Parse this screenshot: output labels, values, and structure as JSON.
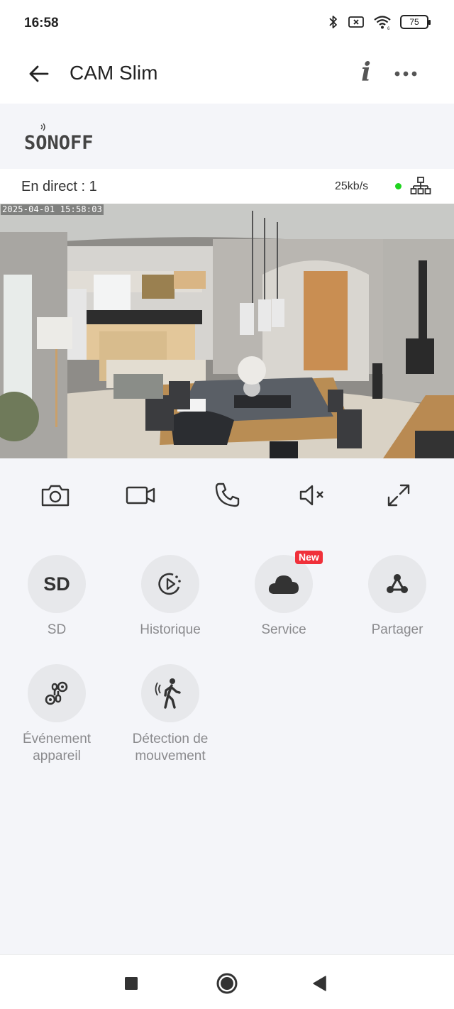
{
  "status_bar": {
    "time": "16:58",
    "battery": "75",
    "icons": [
      "bluetooth-icon",
      "no-sim-icon",
      "wifi-icon",
      "battery-icon"
    ]
  },
  "header": {
    "title": "CAM Slim",
    "info_label": "i"
  },
  "brand": {
    "name": "SONOFF"
  },
  "live": {
    "label": "En direct : 1",
    "bitrate": "25kb/s",
    "status_color": "#1fd41f"
  },
  "video": {
    "timestamp": "2025-04-01 15:58:03"
  },
  "controls": [
    "camera-icon",
    "video-record-icon",
    "phone-icon",
    "mute-icon",
    "fullscreen-icon"
  ],
  "features": {
    "sd": {
      "icon_text": "SD",
      "label": "SD"
    },
    "history": {
      "label": "Historique"
    },
    "service": {
      "label": "Service",
      "badge": "New"
    },
    "share": {
      "label": "Partager"
    },
    "device_event": {
      "label": "Événement appareil"
    },
    "motion": {
      "label": "Détection de mouvement"
    }
  },
  "colors": {
    "accent_badge": "#f0303a",
    "online": "#1fd41f",
    "background": "#f4f5f9"
  }
}
